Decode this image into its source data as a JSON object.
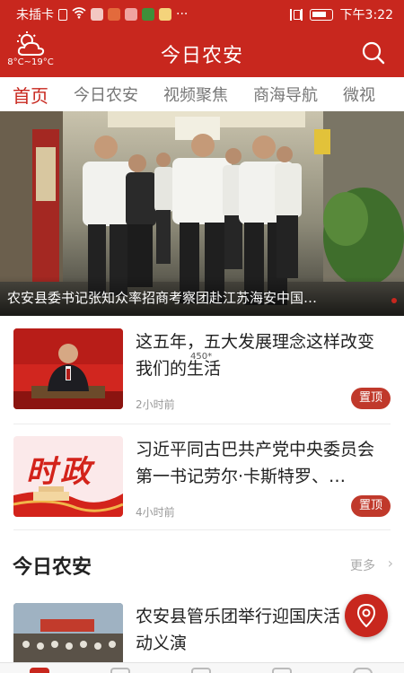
{
  "status_bar": {
    "carrier": "未插卡",
    "more": "···",
    "time": "下午3:22"
  },
  "header": {
    "title": "今日农安",
    "weather_temp": "8°C~19°C"
  },
  "tabs": [
    {
      "label": "首页",
      "active": true
    },
    {
      "label": "今日农安",
      "active": false
    },
    {
      "label": "视频聚焦",
      "active": false
    },
    {
      "label": "商海导航",
      "active": false
    },
    {
      "label": "微视",
      "active": false
    }
  ],
  "hero": {
    "caption": "农安县委书记张知众率招商考察团赴江苏海安中国…"
  },
  "news": [
    {
      "title": "这五年，五大发展理念这样改变我们的生活",
      "time": "2小时前",
      "badge": "置顶"
    },
    {
      "title": "习近平同古巴共产党中央委员会第一书记劳尔·卡斯特罗、…",
      "time": "4小时前",
      "badge": "置顶",
      "thumb_text": "时政"
    }
  ],
  "watermark": "450*",
  "section": {
    "title": "今日农安",
    "more": "更多",
    "chevron": "›"
  },
  "section_news": [
    {
      "title": "农安县管乐团举行迎国庆活动义演"
    }
  ],
  "colors": {
    "brand_red": "#c8271e",
    "badge_red": "#c0392b",
    "tab_inactive": "#777777",
    "time_gray": "#999999"
  },
  "icons": {
    "weather": "partly-cloudy-icon",
    "search": "search-icon",
    "fab": "location-pin-icon"
  }
}
